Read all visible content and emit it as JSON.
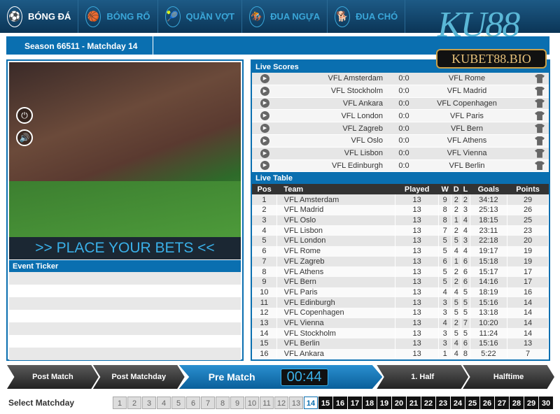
{
  "nav": [
    {
      "label": "BÓNG ĐÁ",
      "icon": "soccer-icon",
      "active": true
    },
    {
      "label": "BÓNG RỔ",
      "icon": "basketball-icon"
    },
    {
      "label": "QUẦN VỢT",
      "icon": "tennis-icon"
    },
    {
      "label": "ĐUA NGỰA",
      "icon": "horse-racing-icon"
    },
    {
      "label": "ĐUA CHÓ",
      "icon": "dog-racing-icon"
    }
  ],
  "logo": {
    "text": "KU88",
    "sub": "BET",
    "domain": "KUBET88.BIO"
  },
  "season": "Season 66511 - Matchday 14",
  "video": {
    "banner": ">> PLACE YOUR BETS <<"
  },
  "event_ticker": {
    "title": "Event Ticker"
  },
  "live_scores": {
    "title": "Live Scores",
    "matches": [
      {
        "home": "VFL Amsterdam",
        "score": "0:0",
        "away": "VFL Rome"
      },
      {
        "home": "VFL Stockholm",
        "score": "0:0",
        "away": "VFL Madrid"
      },
      {
        "home": "VFL Ankara",
        "score": "0:0",
        "away": "VFL Copenhagen"
      },
      {
        "home": "VFL London",
        "score": "0:0",
        "away": "VFL Paris"
      },
      {
        "home": "VFL Zagreb",
        "score": "0:0",
        "away": "VFL Bern"
      },
      {
        "home": "VFL Oslo",
        "score": "0:0",
        "away": "VFL Athens"
      },
      {
        "home": "VFL Lisbon",
        "score": "0:0",
        "away": "VFL Vienna"
      },
      {
        "home": "VFL Edinburgh",
        "score": "0:0",
        "away": "VFL Berlin"
      }
    ]
  },
  "live_table": {
    "title": "Live Table",
    "columns": [
      "Pos",
      "Team",
      "Played",
      "W",
      "D",
      "L",
      "Goals",
      "Points"
    ],
    "rows": [
      [
        "1",
        "VFL Amsterdam",
        "13",
        "9",
        "2",
        "2",
        "34:12",
        "29"
      ],
      [
        "2",
        "VFL Madrid",
        "13",
        "8",
        "2",
        "3",
        "25:13",
        "26"
      ],
      [
        "3",
        "VFL Oslo",
        "13",
        "8",
        "1",
        "4",
        "18:15",
        "25"
      ],
      [
        "4",
        "VFL Lisbon",
        "13",
        "7",
        "2",
        "4",
        "23:11",
        "23"
      ],
      [
        "5",
        "VFL London",
        "13",
        "5",
        "5",
        "3",
        "22:18",
        "20"
      ],
      [
        "6",
        "VFL Rome",
        "13",
        "5",
        "4",
        "4",
        "19:17",
        "19"
      ],
      [
        "7",
        "VFL Zagreb",
        "13",
        "6",
        "1",
        "6",
        "15:18",
        "19"
      ],
      [
        "8",
        "VFL Athens",
        "13",
        "5",
        "2",
        "6",
        "15:17",
        "17"
      ],
      [
        "9",
        "VFL Bern",
        "13",
        "5",
        "2",
        "6",
        "14:16",
        "17"
      ],
      [
        "10",
        "VFL Paris",
        "13",
        "4",
        "4",
        "5",
        "18:19",
        "16"
      ],
      [
        "11",
        "VFL Edinburgh",
        "13",
        "3",
        "5",
        "5",
        "15:16",
        "14"
      ],
      [
        "12",
        "VFL Copenhagen",
        "13",
        "3",
        "5",
        "5",
        "13:18",
        "14"
      ],
      [
        "13",
        "VFL Vienna",
        "13",
        "4",
        "2",
        "7",
        "10:20",
        "14"
      ],
      [
        "14",
        "VFL Stockholm",
        "13",
        "3",
        "5",
        "5",
        "11:24",
        "14"
      ],
      [
        "15",
        "VFL Berlin",
        "13",
        "3",
        "4",
        "6",
        "15:16",
        "13"
      ],
      [
        "16",
        "VFL Ankara",
        "13",
        "1",
        "4",
        "8",
        "5:22",
        "7"
      ]
    ]
  },
  "phases": [
    "Post Match",
    "Post Matchday",
    "Pre Match",
    "1. Half",
    "Halftime"
  ],
  "current_phase": "Pre Match",
  "timer": "00:44",
  "matchday": {
    "label": "Select Matchday",
    "current": 14,
    "days": [
      "1",
      "2",
      "3",
      "4",
      "5",
      "6",
      "7",
      "8",
      "9",
      "10",
      "11",
      "12",
      "13",
      "14",
      "15",
      "16",
      "17",
      "18",
      "19",
      "20",
      "21",
      "22",
      "23",
      "24",
      "25",
      "26",
      "27",
      "28",
      "29",
      "30"
    ]
  },
  "colors": {
    "primary": "#0a6fb0",
    "accent": "#3ab0e8",
    "nav": "#0b3556"
  }
}
